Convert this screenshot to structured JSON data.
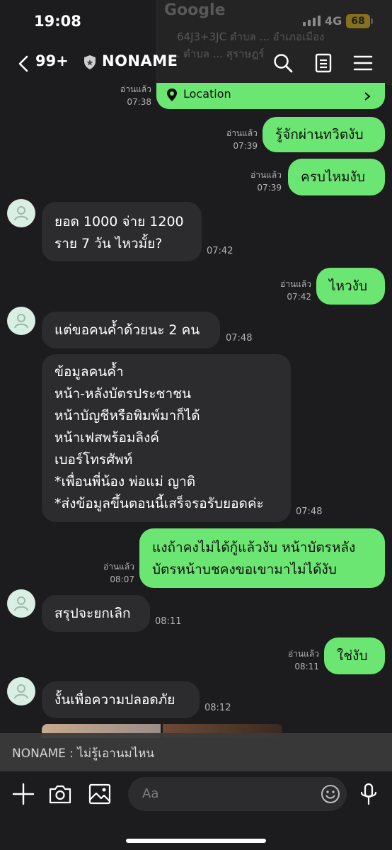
{
  "status": {
    "time": "19:08",
    "network": "4G",
    "battery": "68"
  },
  "header": {
    "back_count": "99+",
    "chat_name": "NONAME"
  },
  "top_preview": {
    "logo": "Google",
    "line1": "64J3+3JC ตำบล ... อำเภอเมือง",
    "line2": "... ตำบล ... สุราษฎร์"
  },
  "location_card": {
    "label": "Location",
    "read": "อ่านแล้ว",
    "time": "07:38"
  },
  "messages": [
    {
      "dir": "out",
      "lines": [
        "รู้จักผ่านทวิตงับ"
      ],
      "read": "อ่านแล้ว",
      "time": "07:39"
    },
    {
      "dir": "out",
      "lines": [
        "ครบไหมงับ"
      ],
      "read": "อ่านแล้ว",
      "time": "07:39"
    },
    {
      "dir": "in",
      "lines": [
        "ยอด 1000 จ่าย 1200",
        "ราย 7 วัน ไหวมั้ย?"
      ],
      "time": "07:42"
    },
    {
      "dir": "out",
      "lines": [
        "ไหวงับ"
      ],
      "read": "อ่านแล้ว",
      "time": "07:42"
    },
    {
      "dir": "in",
      "lines": [
        "แต่ขอคนค้ำด้วยนะ 2 คน"
      ],
      "time": "07:48"
    },
    {
      "dir": "in",
      "lines": [
        "ข้อมูลคนค้ำ",
        "หน้า-หลังบัตรประชาชน",
        "หน้าบัญชีหรือพิมพ์มาก็ได้",
        "หน้าเฟสพร้อมลิงค์",
        "เบอร์โทรศัพท์",
        "*เพื่อนพี่น้อง พ่อแม่ ญาติ",
        "*ส่งข้อมูลขึ้นตอนนี้เสร็จรอรับยอดค่ะ"
      ],
      "time": "07:48"
    },
    {
      "dir": "out",
      "lines": [
        "แงถ้าคงไม่ได้กู้แล้วงับ หน้าบัตรหลัง",
        "บัตรหน้าบชคงขอเขามาไม่ได้งับ"
      ],
      "read": "อ่านแล้ว",
      "time": "08:07"
    },
    {
      "dir": "in",
      "lines": [
        "สรุปจะยกเลิก"
      ],
      "time": "08:11"
    },
    {
      "dir": "out",
      "lines": [
        "ใช่งับ"
      ],
      "read": "อ่านแล้ว",
      "time": "08:11"
    },
    {
      "dir": "in",
      "lines": [
        "งั้นเพื่อความปลอดภัย"
      ],
      "time": "08:12"
    }
  ],
  "last_preview": "NONAME : ไม่รู้เอานมไหน",
  "input": {
    "placeholder": "Aa"
  },
  "icons": {
    "back": "chevron-left-icon",
    "shield": "shield-icon",
    "search": "search-icon",
    "notes": "notes-icon",
    "menu": "menu-icon",
    "pin": "location-pin-icon",
    "add": "plus-icon",
    "camera": "camera-icon",
    "gallery": "image-icon",
    "emoji": "emoji-icon",
    "mic": "microphone-icon",
    "avatar": "user-avatar-icon"
  },
  "colors": {
    "background": "#1c1c1e",
    "outgoing_bubble": "#6ce672",
    "incoming_bubble": "#2c2c2e",
    "battery": "#f2c611"
  }
}
